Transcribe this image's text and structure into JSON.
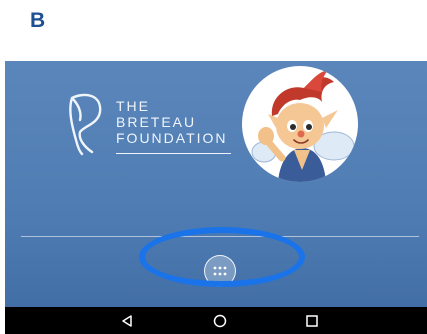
{
  "panel": {
    "label": "B"
  },
  "logo": {
    "line1": "THE",
    "line2": "BRETEAU",
    "line3": "FOUNDATION"
  },
  "colors": {
    "panel_label": "#1f4f93",
    "screen_background": "#4e7cb2",
    "highlight_ring": "#1a73e8",
    "nav_bar": "#000000"
  },
  "icons": {
    "logo_mark": "breteau-logo-icon",
    "mascot": "fairy-mascot-avatar",
    "app_drawer": "app-drawer-grid-icon",
    "back": "back-triangle-icon",
    "home": "home-circle-icon",
    "recents": "recents-square-icon"
  }
}
